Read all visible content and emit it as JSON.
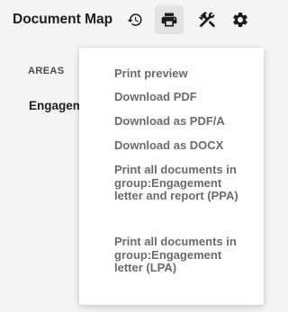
{
  "header": {
    "title": "Document Map",
    "toolbar": {
      "history_icon": "history-icon",
      "print_icon": "print-icon",
      "tools_icon": "tools-icon",
      "settings_icon": "gear-icon"
    }
  },
  "sidebar": {
    "section_label": "AREAS",
    "items": [
      {
        "label": "Engagem"
      }
    ]
  },
  "print_menu": {
    "items": [
      {
        "label": "Print preview"
      },
      {
        "label": "Download PDF"
      },
      {
        "label": "Download as PDF/A"
      },
      {
        "label": "Download as DOCX"
      },
      {
        "label": "Print all documents in group:Engagement letter and report (PPA)"
      },
      {
        "label": "Print all documents in group:Engagement letter (LPA)"
      }
    ]
  },
  "colors": {
    "background": "#f4f4f4",
    "menu_background": "#ffffff",
    "menu_text": "#6b6b6b",
    "active_tool_background": "#e3e3e3",
    "text_dark": "#1c1c1c"
  }
}
